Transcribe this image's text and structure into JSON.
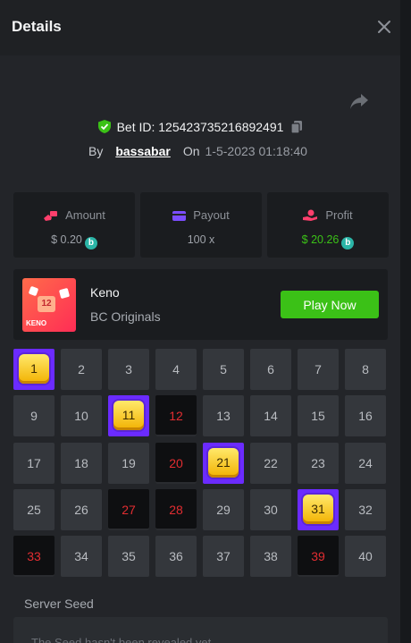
{
  "header": {
    "title": "Details"
  },
  "bet": {
    "id_label": "Bet ID: 125423735216892491",
    "by_label": "By",
    "username": "bassabar",
    "on_label": "On",
    "timestamp": "1-5-2023 01:18:40"
  },
  "stats": {
    "amount": {
      "label": "Amount",
      "value": "$ 0.20"
    },
    "payout": {
      "label": "Payout",
      "value": "100 x"
    },
    "profit": {
      "label": "Profit",
      "value": "$ 20.26"
    }
  },
  "game": {
    "thumb_text": "KENO",
    "thumb_number": "12",
    "name": "Keno",
    "provider": "BC Originals",
    "play_label": "Play Now"
  },
  "keno": {
    "selected_hits": [
      "1",
      "11",
      "21",
      "31"
    ],
    "drawn_misses": [
      "12",
      "20",
      "27",
      "28",
      "33",
      "39"
    ]
  },
  "seed": {
    "label": "Server Seed",
    "text": "The Seed hasn't been revealed yet"
  },
  "colors": {
    "accent_green": "#3bc117",
    "selected_purple": "#6b2bff",
    "miss_red": "#e22d31",
    "profit_green": "#3bc117",
    "coin_teal": "#2bb5a7"
  }
}
